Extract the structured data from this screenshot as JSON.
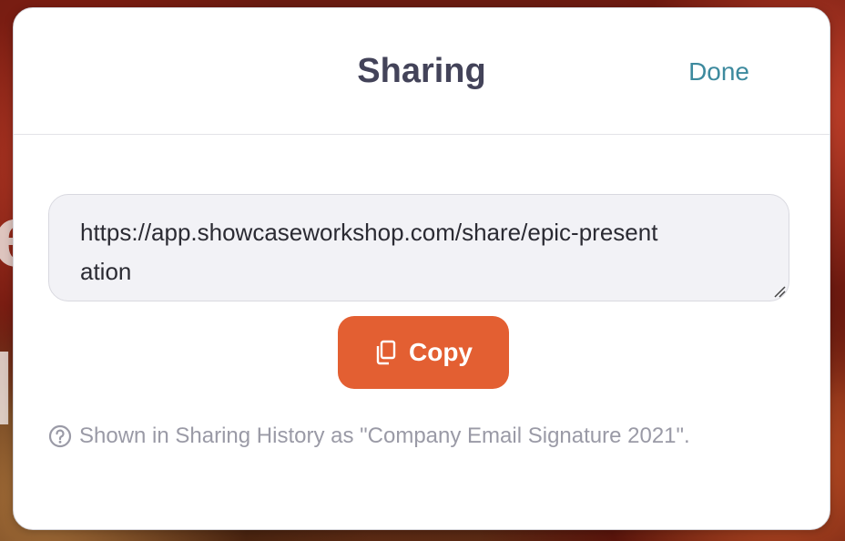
{
  "modal": {
    "title": "Sharing",
    "done_label": "Done"
  },
  "share": {
    "url": "https://app.showcaseworkshop.com/share/epic-presentation"
  },
  "copy_button": {
    "label": "Copy",
    "icon": "copy-icon"
  },
  "info": {
    "icon": "help-circle-icon",
    "text": "Shown in Sharing History as \"Company Email Signature 2021\"."
  },
  "colors": {
    "accent": "#e35f32",
    "link": "#3d8a9e",
    "title": "#434359",
    "muted": "#9a9aa6"
  }
}
